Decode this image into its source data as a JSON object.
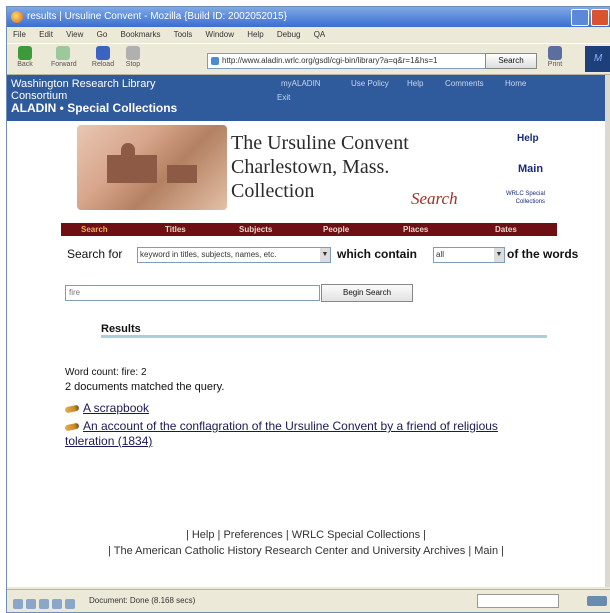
{
  "window": {
    "title": "results | Ursuline Convent - Mozilla {Build ID: 2002052015}"
  },
  "menubar": [
    "File",
    "Edit",
    "View",
    "Go",
    "Bookmarks",
    "Tools",
    "Window",
    "Help",
    "Debug",
    "QA"
  ],
  "toolbar": {
    "back_label": "Back",
    "forward_label": "Forward",
    "reload_label": "Reload",
    "stop_label": "Stop",
    "url": "http://www.aladin.wrlc.org/gsdl/cgi-bin/library?a=q&r=1&hs=1",
    "search_label": "Search",
    "print_label": "Print"
  },
  "banner": {
    "org_line1": "Washington Research Library",
    "org_line2": "Consortium",
    "org_line3": "ALADIN • Special Collections",
    "nav": [
      "myALADIN",
      "Use Policy",
      "Help",
      "Comments",
      "Home"
    ],
    "exit": "Exit"
  },
  "collection": {
    "title_line1": "The Ursuline Convent",
    "title_line2": "Charlestown, Mass.",
    "title_line3": "Collection",
    "search_word": "Search",
    "help": "Help",
    "main": "Main",
    "wrlc_line1": "WRLC Special",
    "wrlc_line2": "Collections"
  },
  "tabs": [
    "Search",
    "Titles",
    "Subjects",
    "People",
    "Places",
    "Dates"
  ],
  "search": {
    "search_for_label": "Search for",
    "field_select": "keyword in titles, subjects, names, etc.",
    "which_contain_label": "which contain",
    "quantifier_select": "all",
    "of_the_words_label": "of the words",
    "query": "fire",
    "begin_button": "Begin Search"
  },
  "results": {
    "heading": "Results",
    "word_count": "Word count: fire: 2",
    "matched": "2 documents matched the query.",
    "items": [
      "A scrapbook",
      "An account of the conflagration of the Ursuline Convent by a friend of religious toleration (1834)"
    ]
  },
  "footer": {
    "line1": "| Help | Preferences | WRLC Special Collections |",
    "line2": "| The American Catholic History Research Center and University Archives | Main |"
  },
  "status": {
    "text": "Document: Done (8.168 secs)"
  }
}
